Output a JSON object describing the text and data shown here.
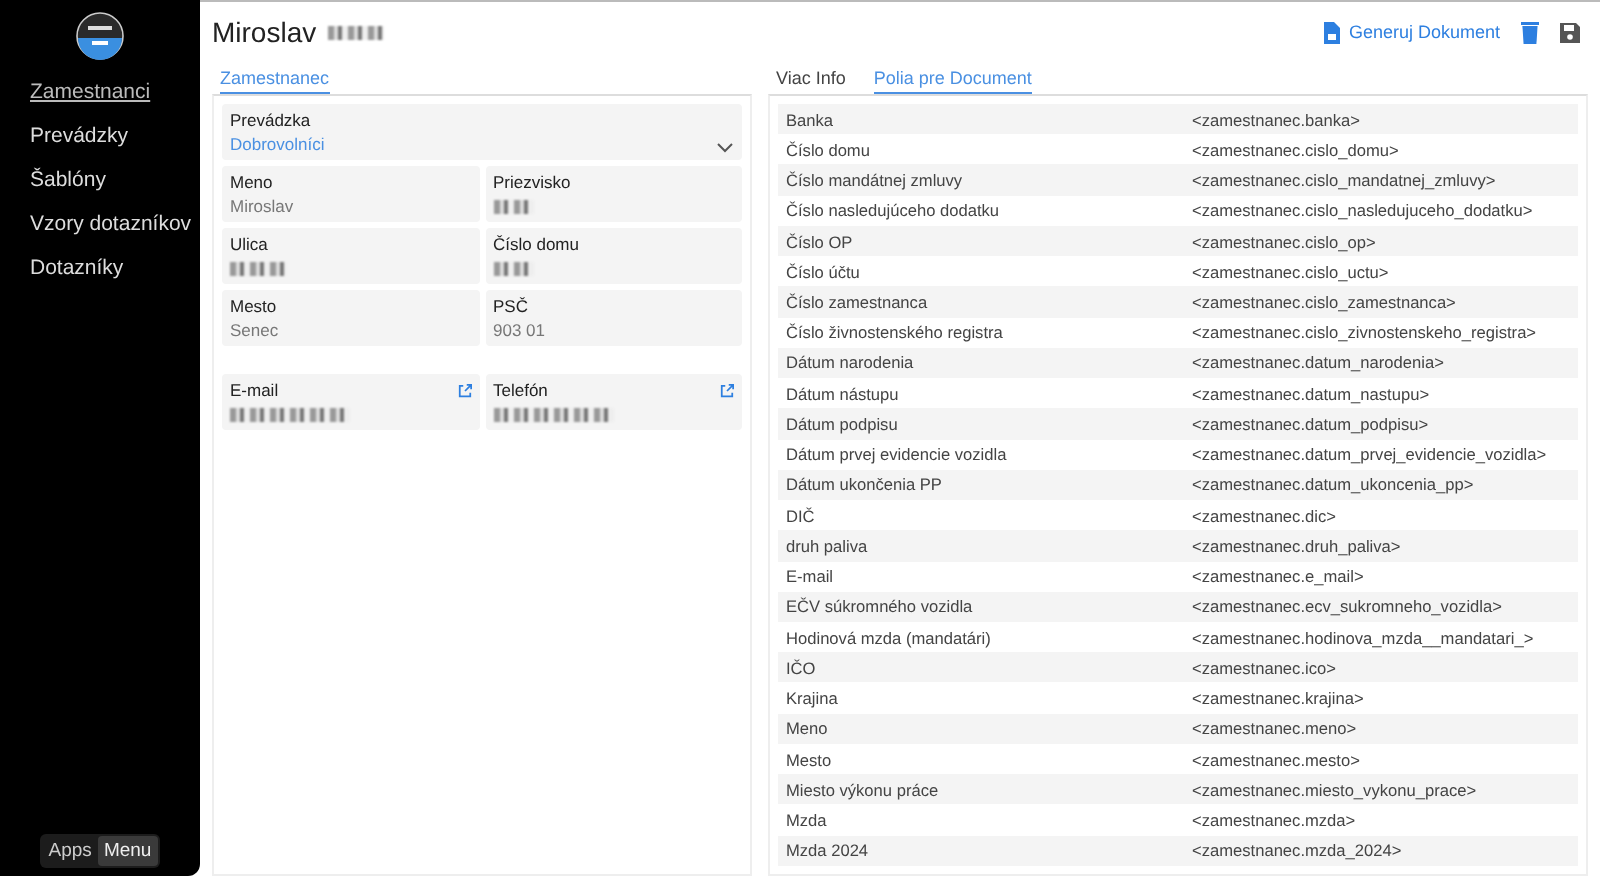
{
  "sidebar": {
    "items": [
      {
        "label": "Zamestnanci",
        "selected": true
      },
      {
        "label": "Prevádzky",
        "selected": false
      },
      {
        "label": "Šablóny",
        "selected": false
      },
      {
        "label": "Vzory dotazníkov",
        "selected": false
      },
      {
        "label": "Dotazníky",
        "selected": false
      }
    ],
    "switch": [
      {
        "label": "Apps",
        "selected": false
      },
      {
        "label": "Menu",
        "selected": true
      }
    ]
  },
  "header": {
    "title": "Miroslav",
    "title_redacted": true,
    "generate_button": "Generuj Dokument"
  },
  "left_tabs": [
    {
      "label": "Zamestnanec",
      "selected": true
    }
  ],
  "form": {
    "select": {
      "label": "Prevádzka",
      "value": "Dobrovolníci"
    },
    "fields": [
      {
        "label": "Meno",
        "value": "Miroslav",
        "redacted": false,
        "link": false
      },
      {
        "label": "Priezvisko",
        "redacted": true,
        "link": false
      },
      {
        "label": "Ulica",
        "redacted": true,
        "link": false
      },
      {
        "label": "Číslo domu",
        "redacted": true,
        "link": false
      },
      {
        "label": "Mesto",
        "value": "Senec",
        "redacted": false,
        "link": false
      },
      {
        "label": "PSČ",
        "value": "903 01",
        "redacted": false,
        "link": false
      }
    ],
    "contact_fields": [
      {
        "label": "E-mail",
        "redacted": true,
        "link": true
      },
      {
        "label": "Telefón",
        "redacted": true,
        "link": true
      }
    ]
  },
  "right_tabs": [
    {
      "label": "Viac Info",
      "selected": false
    },
    {
      "label": "Polia pre Document",
      "selected": true
    }
  ],
  "table": {
    "rows": [
      [
        "Banka",
        "<zamestnanec.banka>"
      ],
      [
        "Číslo domu",
        "<zamestnanec.cislo_domu>"
      ],
      [
        "Číslo mandátnej zmluvy",
        "<zamestnanec.cislo_mandatnej_zmluvy>"
      ],
      [
        "Číslo nasledujúceho dodatku",
        "<zamestnanec.cislo_nasledujuceho_dodatku>"
      ],
      [
        "Číslo OP",
        "<zamestnanec.cislo_op>"
      ],
      [
        "Číslo účtu",
        "<zamestnanec.cislo_uctu>"
      ],
      [
        "Číslo zamestnanca",
        "<zamestnanec.cislo_zamestnanca>"
      ],
      [
        "Číslo živnostenského registra",
        "<zamestnanec.cislo_zivnostenskeho_registra>"
      ],
      [
        "Dátum narodenia",
        "<zamestnanec.datum_narodenia>"
      ],
      [
        "Dátum nástupu",
        "<zamestnanec.datum_nastupu>"
      ],
      [
        "Dátum podpisu",
        "<zamestnanec.datum_podpisu>"
      ],
      [
        "Dátum prvej evidencie vozidla",
        "<zamestnanec.datum_prvej_evidencie_vozidla>"
      ],
      [
        "Dátum ukončenia PP",
        "<zamestnanec.datum_ukoncenia_pp>"
      ],
      [
        "DIČ",
        "<zamestnanec.dic>"
      ],
      [
        "druh paliva",
        "<zamestnanec.druh_paliva>"
      ],
      [
        "E-mail",
        "<zamestnanec.e_mail>"
      ],
      [
        "EČV súkromného vozidla",
        "<zamestnanec.ecv_sukromneho_vozidla>"
      ],
      [
        "Hodinová mzda (mandatári)",
        "<zamestnanec.hodinova_mzda__mandatari_>"
      ],
      [
        "IČO",
        "<zamestnanec.ico>"
      ],
      [
        "Krajina",
        "<zamestnanec.krajina>"
      ],
      [
        "Meno",
        "<zamestnanec.meno>"
      ],
      [
        "Mesto",
        "<zamestnanec.mesto>"
      ],
      [
        "Miesto výkonu práce",
        "<zamestnanec.miesto_vykonu_prace>"
      ],
      [
        "Mzda",
        "<zamestnanec.mzda>"
      ],
      [
        "Mzda 2024",
        "<zamestnanec.mzda_2024>"
      ]
    ]
  }
}
